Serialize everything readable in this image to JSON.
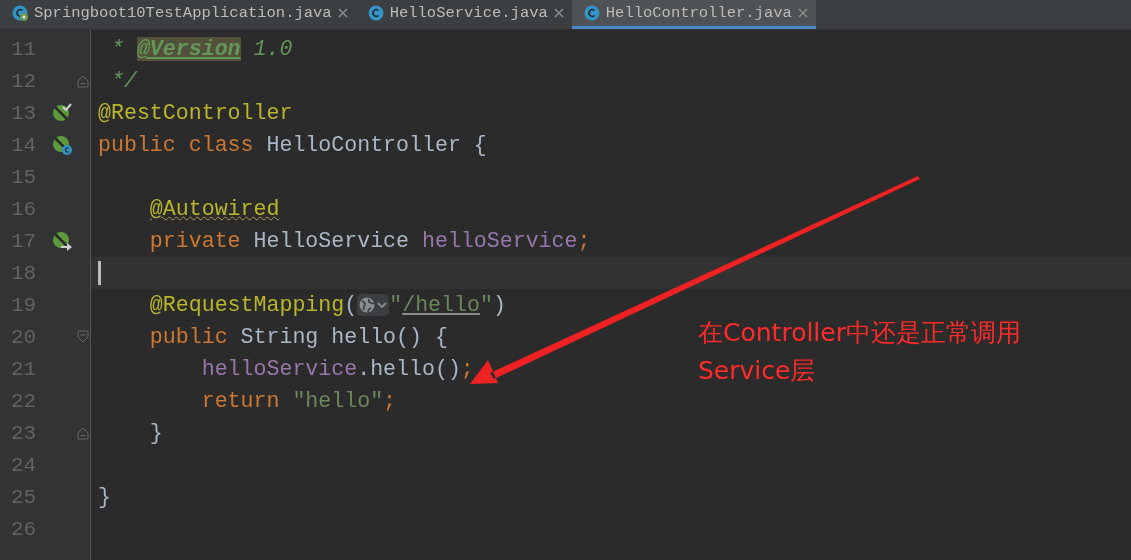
{
  "tabs": [
    {
      "label": "Springboot10TestApplication.java",
      "kind": "spring_class",
      "selected": false
    },
    {
      "label": "HelloService.java",
      "kind": "class",
      "selected": false
    },
    {
      "label": "HelloController.java",
      "kind": "class",
      "selected": true
    }
  ],
  "lines": [
    {
      "number": "11",
      "tokens": [
        {
          "text": " * ",
          "kind": "comment"
        },
        {
          "text": "@Version",
          "kind": "doctag"
        },
        {
          "text": " 1.0",
          "kind": "comment"
        }
      ]
    },
    {
      "number": "12",
      "fold": {
        "kind": "end"
      },
      "tokens": [
        {
          "text": " */",
          "kind": "comment"
        }
      ]
    },
    {
      "number": "13",
      "gutter": {
        "kind": "bean_check"
      },
      "tokens": [
        {
          "text": "@RestController",
          "kind": "annotation"
        }
      ]
    },
    {
      "number": "14",
      "gutter": {
        "kind": "bean_class"
      },
      "tokens": [
        {
          "text": "public class ",
          "kind": "keyword"
        },
        {
          "text": "HelloController {",
          "kind": "plain"
        }
      ]
    },
    {
      "number": "15"
    },
    {
      "number": "16",
      "tokens": [
        {
          "text": "    @Autowired",
          "kind": "annotation_warning"
        }
      ]
    },
    {
      "number": "17",
      "gutter": {
        "kind": "bean_arrow"
      },
      "tokens": [
        {
          "text": "    private ",
          "kind": "keyword"
        },
        {
          "text": "HelloService ",
          "kind": "plain"
        },
        {
          "text": "helloService",
          "kind": "field"
        },
        {
          "text": ";",
          "kind": "keyword"
        }
      ]
    },
    {
      "number": "18",
      "current": true
    },
    {
      "number": "19",
      "tokens": [
        {
          "text": "    @RequestMapping",
          "kind": "annotation"
        },
        {
          "text": "(",
          "kind": "plain"
        },
        {
          "kind": "globe_widget"
        },
        {
          "text": "\"",
          "kind": "string"
        },
        {
          "text": "/hello",
          "kind": "string_link"
        },
        {
          "text": "\"",
          "kind": "string"
        },
        {
          "text": ")",
          "kind": "plain"
        }
      ]
    },
    {
      "number": "20",
      "fold": {
        "kind": "start"
      },
      "tokens": [
        {
          "text": "    public ",
          "kind": "keyword"
        },
        {
          "text": "String hello() {",
          "kind": "plain"
        }
      ]
    },
    {
      "number": "21",
      "tokens": [
        {
          "text": "        helloService",
          "kind": "field"
        },
        {
          "text": ".hello()",
          "kind": "plain"
        },
        {
          "text": ";",
          "kind": "keyword"
        }
      ]
    },
    {
      "number": "22",
      "tokens": [
        {
          "text": "        return ",
          "kind": "keyword"
        },
        {
          "text": "\"hello\"",
          "kind": "string"
        },
        {
          "text": ";",
          "kind": "keyword"
        }
      ]
    },
    {
      "number": "23",
      "fold": {
        "kind": "end"
      },
      "tokens": [
        {
          "text": "    }",
          "kind": "plain"
        }
      ]
    },
    {
      "number": "24"
    },
    {
      "number": "25",
      "tokens": [
        {
          "text": "}",
          "kind": "plain"
        }
      ]
    },
    {
      "number": "26"
    }
  ],
  "annotation": {
    "lines": [
      "在Controller中还是正常调用",
      "Service层"
    ]
  }
}
